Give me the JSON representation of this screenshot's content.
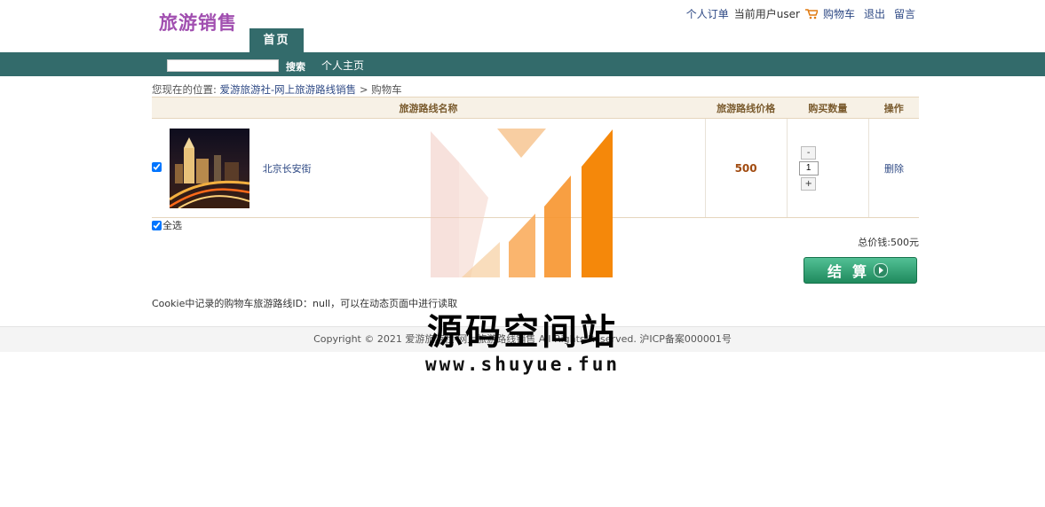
{
  "header": {
    "logo": "旅游销售",
    "links": {
      "orders": "个人订单",
      "current_user": "当前用户user",
      "cart": "购物车",
      "logout": "退出",
      "message": "留言"
    },
    "home_tab": "首页"
  },
  "nav": {
    "search_value": "",
    "search_button": "搜索",
    "personal_home": "个人主页"
  },
  "breadcrumb": {
    "prefix": "您现在的位置:",
    "site": "爱游旅游社-网上旅游路线销售",
    "separator": ">",
    "current": "购物车"
  },
  "cart": {
    "headers": {
      "name": "旅游路线名称",
      "price": "旅游路线价格",
      "quantity": "购买数量",
      "action": "操作"
    },
    "rows": [
      {
        "checked": true,
        "name": "北京长安街",
        "price": "500",
        "quantity": "1",
        "minus": "-",
        "plus": "+",
        "delete": "删除"
      }
    ],
    "select_all": "全选",
    "total": "总价钱:500元",
    "checkout": "结算"
  },
  "cookie_note": "Cookie中记录的购物车旅游路线ID：null，可以在动态页面中进行读取",
  "footer": "Copyright © 2021 爱游旅游社-网上旅游路线销售 All Rights Reserved. 沪ICP备案000001号",
  "watermark": {
    "title": "源码空间站",
    "url": "www.shuyue.fun"
  },
  "colors": {
    "brand": "#a14fb0",
    "nav_bg": "#336b6b",
    "price": "#a14b10",
    "link": "#2f4a85"
  }
}
